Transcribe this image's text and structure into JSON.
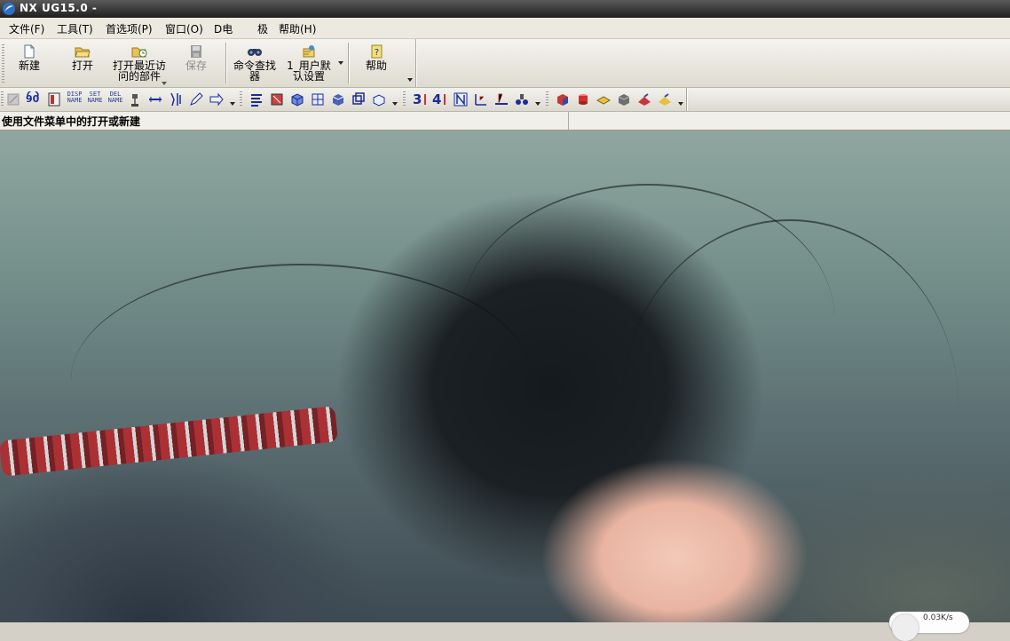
{
  "window": {
    "title": "NX  UG15.0 -"
  },
  "menu": [
    "文件(F)",
    "工具(T)",
    "首选项(P)",
    "窗口(O)",
    "D电",
    "极",
    "帮助(H)"
  ],
  "standard_toolbar": {
    "new_label": "新建",
    "open_label": "打开",
    "recent_line1": "打开最近访",
    "recent_line2": "问的部件",
    "save_label": "保存",
    "finder_line1": "命令查找",
    "finder_line2": "器",
    "user_line1": "1_用户默",
    "user_line2": "认设置",
    "help_label": "帮助"
  },
  "icon_toolbar": {
    "disp_label": "DISP\nNAME",
    "set_label": "SET\nNAME",
    "del_label": "DEL\nNAME",
    "n90": "90",
    "n3": "3",
    "n4": "4"
  },
  "status": {
    "message": "使用文件菜单中的打开或新建"
  },
  "network_badge": {
    "speed": "0.03K/s"
  },
  "colors": {
    "title_bar": "#1e1e1e",
    "menu_bg": "#ece9e0",
    "toolbar_bg": "#dedbd0"
  }
}
